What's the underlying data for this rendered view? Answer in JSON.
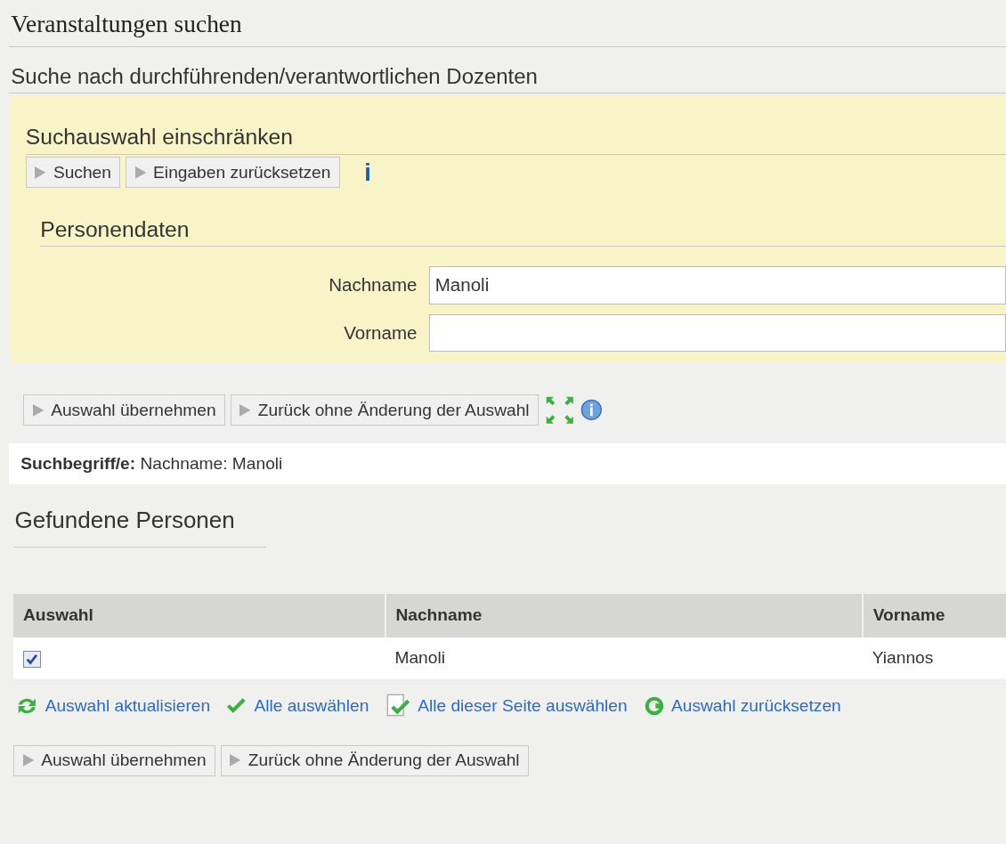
{
  "page_title": "Veranstaltungen suchen",
  "subtitle": "Suche nach durchführenden/verantwortlichen Dozenten",
  "search_panel": {
    "title": "Suchauswahl einschränken",
    "buttons": [
      "Suchen",
      "Eingaben zurücksetzen"
    ],
    "info": "i",
    "section": "Personendaten",
    "fields": [
      {
        "label": "Nachname",
        "value": "Manoli"
      },
      {
        "label": "Vorname"
      }
    ]
  },
  "action_buttons": [
    "Auswahl übernehmen",
    "Zurück ohne Änderung der Auswahl"
  ],
  "search_terms": "**Suchbegriff/e:** Nachname: Manoli",
  "results_title": "Gefundene Personen",
  "table": {
    "columns": [
      "Auswahl",
      "Nachname",
      "Vorname"
    ],
    "rows": [
      {
        "checked": true,
        "cells": [
          "",
          "Manoli",
          "Yiannos"
        ]
      }
    ]
  },
  "links": [
    {
      "kind": "refresh",
      "label": "Auswahl aktualisieren"
    },
    {
      "kind": "check",
      "label": "Alle auswählen"
    },
    {
      "kind": "page",
      "label": "Alle dieser Seite auswählen"
    },
    {
      "kind": "reset",
      "label": "Auswahl zurücksetzen"
    }
  ],
  "bottom_buttons": [
    "Auswahl übernehmen",
    "Zurück ohne Änderung der Auswahl"
  ]
}
